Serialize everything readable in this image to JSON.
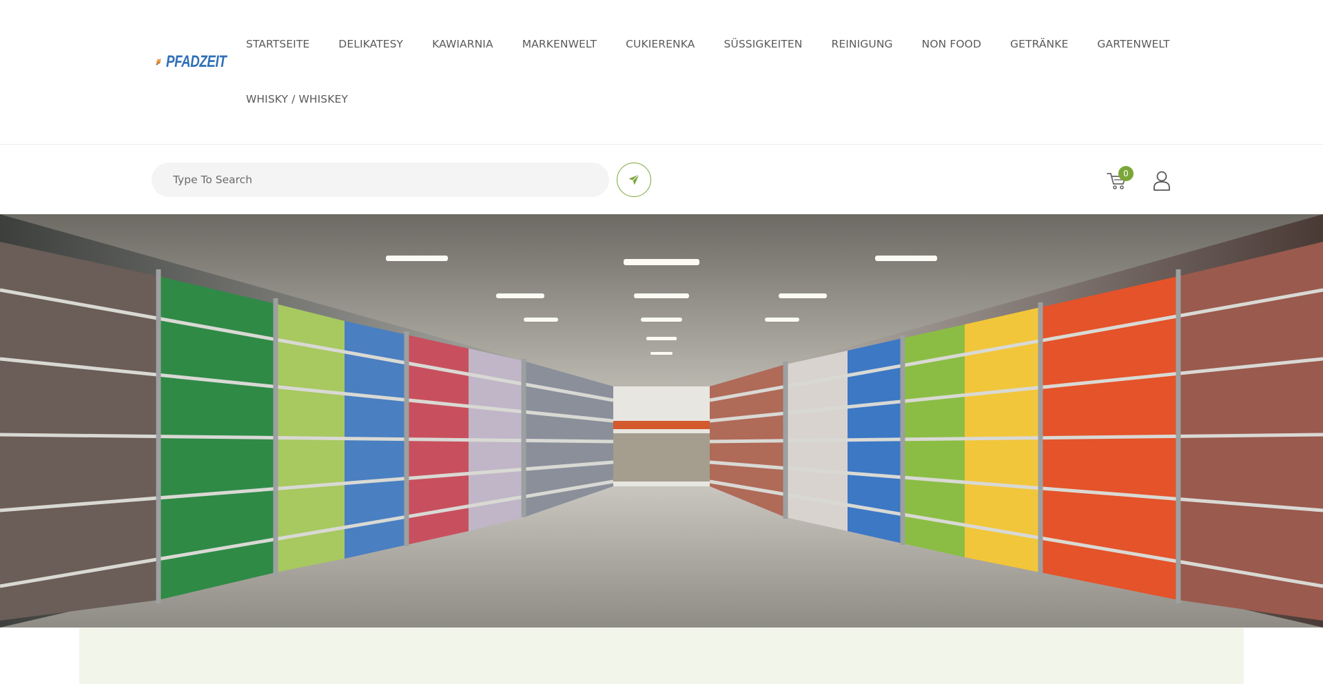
{
  "brand": {
    "name": "PFADZEIT",
    "logo_icon": "hand-truck-with-boxes-icon",
    "logo_color": "#2f6fb7",
    "logo_accent": "#e88a2e"
  },
  "nav": {
    "row1": [
      "STARTSEITE",
      "DELIKATESY",
      "KAWIARNIA",
      "MARKENWELT",
      "CUKIERENKA",
      "SÜSSIGKEITEN",
      "REINIGUNG",
      "NON FOOD",
      "GETRÄNKE",
      "GARTENWELT"
    ],
    "row2": [
      "WHISKY / WHISKEY"
    ]
  },
  "search": {
    "placeholder": "Type To Search",
    "button_icon": "paper-plane-icon"
  },
  "cart": {
    "icon": "shopping-cart-icon",
    "count": "0"
  },
  "account": {
    "icon": "user-icon"
  },
  "hero": {
    "description_icon": "supermarket-aisle-image"
  },
  "colors": {
    "accent": "#7aa63a",
    "nav_text": "#5a5a5a",
    "bottom_panel": "#f2f6ea"
  }
}
